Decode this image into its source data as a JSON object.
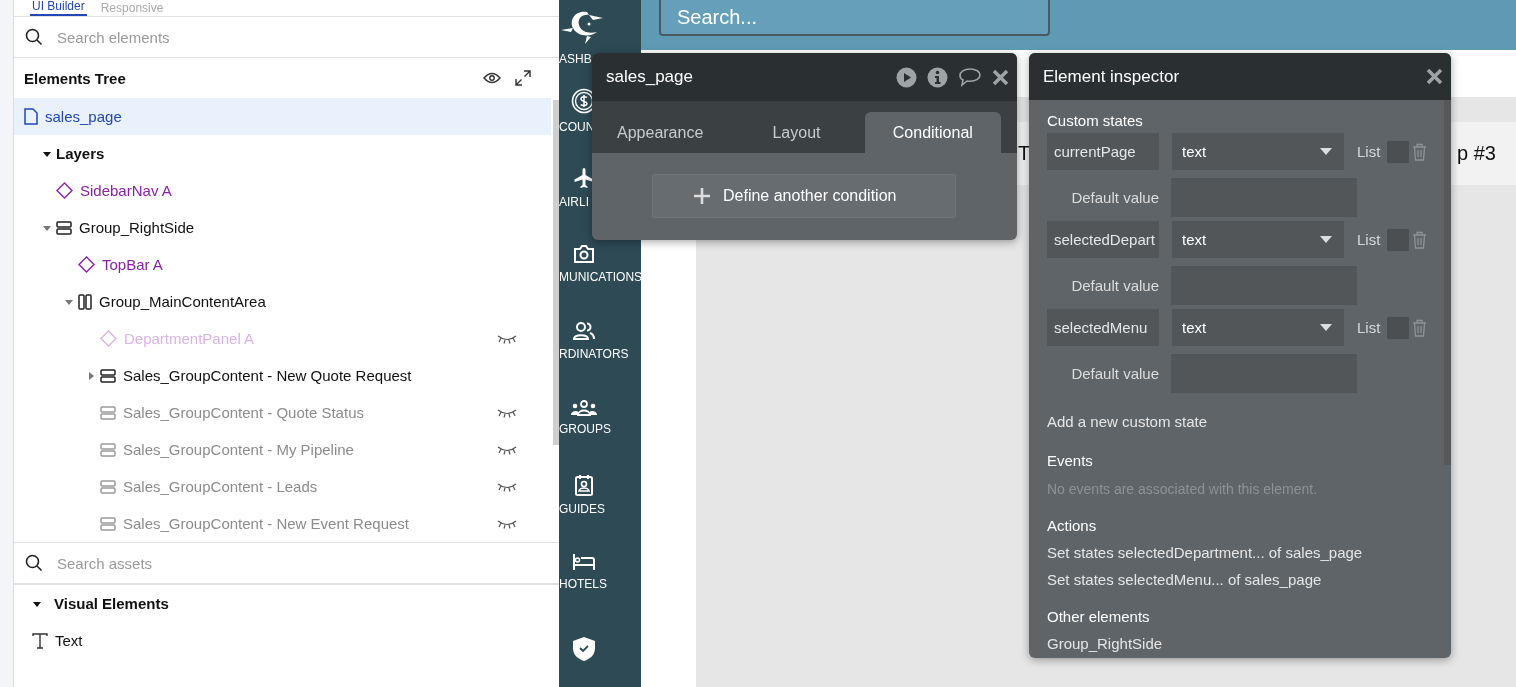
{
  "builder_tabs": [
    {
      "label": "UI Builder",
      "selected": true
    },
    {
      "label": "Responsive",
      "selected": false
    }
  ],
  "element_search": {
    "placeholder": "Search elements"
  },
  "elements_tree": {
    "title": "Elements Tree",
    "items": [
      {
        "label": "sales_page",
        "kind": "page",
        "selected": true,
        "hidden": false
      },
      {
        "label": "Layers",
        "kind": "section",
        "selected": false,
        "hidden": false,
        "expanded": true,
        "children": [
          {
            "label": "SidebarNav A",
            "kind": "reusable",
            "selected": false,
            "hidden": false
          },
          {
            "label": "Group_RightSide",
            "kind": "group",
            "selected": false,
            "hidden": false,
            "expanded": true,
            "children": [
              {
                "label": "TopBar A",
                "kind": "reusable",
                "selected": false,
                "hidden": false
              },
              {
                "label": "Group_MainContentArea",
                "kind": "row",
                "selected": false,
                "hidden": false,
                "expanded": true,
                "children": [
                  {
                    "label": "DepartmentPanel A",
                    "kind": "reusable",
                    "selected": false,
                    "hidden": true
                  },
                  {
                    "label": "Sales_GroupContent - New Quote Request",
                    "kind": "group",
                    "selected": false,
                    "hidden": false,
                    "expanded": false
                  },
                  {
                    "label": "Sales_GroupContent - Quote Status",
                    "kind": "group",
                    "selected": false,
                    "hidden": true
                  },
                  {
                    "label": "Sales_GroupContent - My Pipeline",
                    "kind": "group",
                    "selected": false,
                    "hidden": true
                  },
                  {
                    "label": "Sales_GroupContent - Leads",
                    "kind": "group",
                    "selected": false,
                    "hidden": true
                  },
                  {
                    "label": "Sales_GroupContent - New Event Request",
                    "kind": "group",
                    "selected": false,
                    "hidden": true
                  }
                ]
              }
            ]
          }
        ]
      }
    ]
  },
  "asset_search": {
    "placeholder": "Search assets"
  },
  "visual_elements": {
    "title": "Visual Elements",
    "expanded": true,
    "items": [
      {
        "label": "Text",
        "kind": "text"
      }
    ]
  },
  "nav_sidebar": {
    "items": [
      {
        "label": "ASHB",
        "kind": "logo"
      },
      {
        "label": "COUN",
        "kind": "dollar"
      },
      {
        "label": "AIRLI",
        "kind": "plane"
      },
      {
        "label": "MUNICATIONS",
        "kind": "camera"
      },
      {
        "label": "RDINATORS",
        "kind": "people"
      },
      {
        "label": "GROUPS",
        "kind": "groups"
      },
      {
        "label": "GUIDES",
        "kind": "badge"
      },
      {
        "label": "HOTELS",
        "kind": "bed"
      },
      {
        "kind": "shield"
      }
    ]
  },
  "top_bar": {
    "search": {
      "placeholder": "Search..."
    }
  },
  "canvas": {
    "texts": [
      "T",
      "p #3"
    ]
  },
  "page_panel": {
    "title": "sales_page",
    "tabs": [
      {
        "label": "Appearance",
        "selected": false
      },
      {
        "label": "Layout",
        "selected": false
      },
      {
        "label": "Conditional",
        "selected": true
      }
    ],
    "button": {
      "label": "Define another condition"
    }
  },
  "inspector": {
    "title": "Element inspector",
    "custom_states_title": "Custom states",
    "states": [
      {
        "name": "currentPage",
        "type": "text",
        "list_label": "List",
        "checked": false,
        "default_label": "Default value"
      },
      {
        "name": "selectedDepart",
        "type": "text",
        "list_label": "List",
        "checked": false,
        "default_label": "Default value"
      },
      {
        "name": "selectedMenu",
        "type": "text",
        "list_label": "List",
        "checked": false,
        "default_label": "Default value"
      }
    ],
    "add_state": "Add a new custom state",
    "events": {
      "title": "Events",
      "empty": "No events are associated with this element."
    },
    "actions": {
      "title": "Actions",
      "items": [
        "Set states selectedDepartment... of sales_page",
        "Set states selectedMenu... of sales_page"
      ]
    },
    "other_elements": {
      "title": "Other elements",
      "items": [
        "Group_RightSide"
      ]
    }
  }
}
